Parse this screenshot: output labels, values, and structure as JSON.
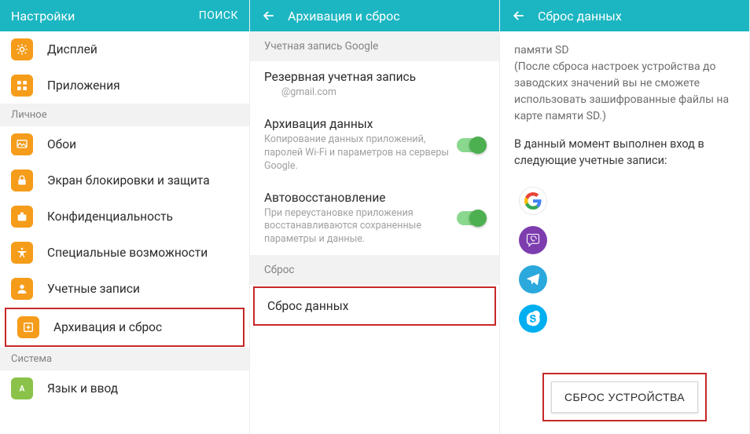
{
  "panel1": {
    "header": {
      "title": "Настройки",
      "search": "ПОИСК"
    },
    "items_top": [
      {
        "label": "Дисплей"
      },
      {
        "label": "Приложения"
      }
    ],
    "section_personal": "Личное",
    "items_personal": [
      {
        "label": "Обои"
      },
      {
        "label": "Экран блокировки и защита"
      },
      {
        "label": "Конфиденциальность"
      },
      {
        "label": "Специальные возможности"
      },
      {
        "label": "Учетные записи"
      }
    ],
    "item_backup_reset": {
      "label": "Архивация и сброс"
    },
    "section_system": "Система",
    "items_system": [
      {
        "label": "Язык и ввод"
      }
    ]
  },
  "panel2": {
    "header": {
      "title": "Архивация и сброс"
    },
    "section_google": "Учетная запись Google",
    "backup_account": {
      "title": "Резервная учетная запись",
      "sub": "@gmail.com"
    },
    "backup_data": {
      "title": "Архивация данных",
      "sub": "Копирование данных приложений, паролей Wi-Fi и параметров на серверы Google."
    },
    "auto_restore": {
      "title": "Автовосстановление",
      "sub": "При переустановке приложения восстанавливаются сохраненные параметры и данные."
    },
    "section_reset": "Сброс",
    "reset_data": "Сброс данных"
  },
  "panel3": {
    "header": {
      "title": "Сброс данных"
    },
    "sd_title": "памяти SD",
    "sd_note": "(После сброса настроек устройства до заводских значений вы не сможете использовать зашифрованные файлы на карте памяти SD.)",
    "accounts_intro": "В данный момент выполнен вход в следующие учетные записи:",
    "reset_button": "СБРОС УСТРОЙСТВА"
  }
}
